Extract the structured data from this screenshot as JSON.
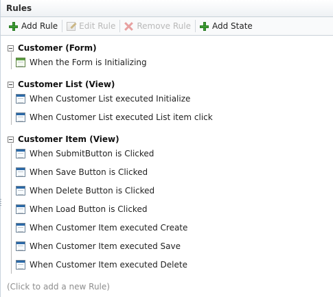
{
  "panel": {
    "title": "Rules"
  },
  "toolbar": {
    "add_rule": "Add Rule",
    "edit_rule": "Edit Rule",
    "remove_rule": "Remove Rule",
    "add_state": "Add State"
  },
  "tree": {
    "groups": [
      {
        "title": "Customer (Form)",
        "items": [
          {
            "label": "When the Form is Initializing"
          }
        ]
      },
      {
        "title": "Customer List (View)",
        "items": [
          {
            "label": "When Customer List executed Initialize"
          },
          {
            "label": "When Customer List executed List item click"
          }
        ]
      },
      {
        "title": "Customer Item (View)",
        "items": [
          {
            "label": "When SubmitButton is Clicked"
          },
          {
            "label": "When Save Button is Clicked"
          },
          {
            "label": "When Delete Button is Clicked"
          },
          {
            "label": "When Load Button is Clicked"
          },
          {
            "label": "When Customer Item executed Create"
          },
          {
            "label": "When Customer Item executed Save"
          },
          {
            "label": "When Customer Item executed Delete"
          }
        ]
      }
    ]
  },
  "footer": {
    "add_new_rule": "(Click to add a new Rule)"
  },
  "icons": {
    "add": "plus-icon",
    "edit": "edit-icon",
    "remove": "close-icon",
    "collapse": "minus-box-icon",
    "rule": "rule-icon"
  },
  "colors": {
    "border": "#c8d1d8",
    "add_green": "#3f9f34",
    "disabled_text": "#b9b9b9",
    "rule_blue": "#2a69a8"
  }
}
